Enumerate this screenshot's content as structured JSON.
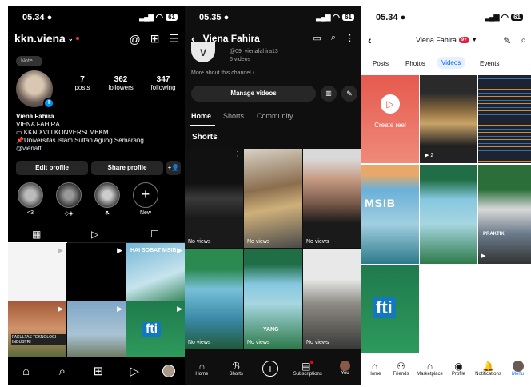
{
  "ig": {
    "time": "05.34",
    "battery": "61",
    "username": "kkn.viena",
    "note": "Note...",
    "stats": [
      {
        "value": "7",
        "label": "posts"
      },
      {
        "value": "362",
        "label": "followers"
      },
      {
        "value": "347",
        "label": "following"
      }
    ],
    "display_name": "Viena Fahira",
    "bio": [
      "VIENA FAHIRA",
      "KKN XVIII KONVERSI MBKM",
      "Universitas Islam Sultan Agung Semarang"
    ],
    "link": "@vienaft",
    "edit_profile": "Edit profile",
    "share_profile": "Share profile",
    "highlights": [
      {
        "label": "<3"
      },
      {
        "label": "◇◈"
      },
      {
        "label": "☘"
      },
      {
        "label": "New"
      }
    ],
    "tile_texts": {
      "msib": "HAI SOBAT MSIB",
      "fti": "fti",
      "sign": "FAKULTAS TEKNOLOGI INDUSTRI"
    }
  },
  "yt": {
    "time": "05.35",
    "battery": "61",
    "channel_title": "Viena Fahira",
    "avatar_letter": "V",
    "handle": "@09_vienafahira13",
    "videos_count": "6 videos",
    "more_about": "More about this channel",
    "manage_videos": "Manage videos",
    "tabs": [
      "Home",
      "Shorts",
      "Community"
    ],
    "section": "Shorts",
    "shorts": [
      {
        "views": "No views"
      },
      {
        "views": "No views"
      },
      {
        "views": "No views"
      },
      {
        "views": "No views"
      },
      {
        "views": "No views"
      },
      {
        "views": "No views"
      }
    ],
    "short_caption": "YANG",
    "nav": [
      "Home",
      "Shorts",
      "",
      "Subscriptions",
      "You"
    ]
  },
  "fb": {
    "time": "05.34",
    "battery": "61",
    "profile_name": "Viena Fahira",
    "badge": "9+",
    "tabs": [
      "Posts",
      "Photos",
      "Videos",
      "Events"
    ],
    "active_tab": "Videos",
    "create_reel": "Create reel",
    "video_count": "2",
    "msib": "MSIB",
    "fti": "fti",
    "praktik": "PRAKTIK",
    "nav": [
      "Home",
      "Friends",
      "Marketplace",
      "Profile",
      "Notifications",
      "Menu"
    ]
  },
  "colors": {
    "ig_blue": "#0095f6",
    "yt_dark": "#0f0f0f",
    "fb_blue": "#0866ff",
    "reel_red": "#e8504a"
  }
}
